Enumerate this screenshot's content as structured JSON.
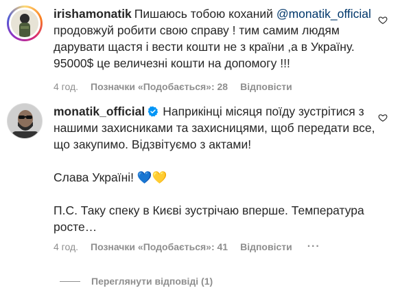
{
  "comments": [
    {
      "username": "irishamonatik",
      "text_before_mention": "Пишаюсь тобою коханий ",
      "mention": "@monatik_official",
      "text_lines": [
        "продовжуй робити свою справу ! тим самим людям",
        "дарувати щастя і вести кошти не з країни ,а в Україну.",
        "95000$ це величезні кошти на допомогу !!!"
      ],
      "time": "4 год.",
      "likes": "Позначки «Подобається»: 28",
      "reply_label": "Відповісти"
    },
    {
      "username": "monatik_official",
      "verified": true,
      "paragraphs": [
        "Наприкінці місяця поїду зустрітися з нашими захисниками та захисницями, щоб передати все, що закупимо. Відзвітуємо з актами!",
        "Слава Україні! 💙💛",
        "П.С. Таку спеку в Києві зустрічаю вперше. Температура росте…"
      ],
      "time": "4 год.",
      "likes": "Позначки «Подобається»: 41",
      "reply_label": "Відповісти",
      "more_label": "···"
    }
  ],
  "replies_toggle": "Переглянути відповіді (1)",
  "colors": {
    "text": "#262626",
    "meta": "#8e8e8e",
    "mention": "#00376b",
    "verified": "#0095f6"
  },
  "icons": [
    "heart-outline-icon",
    "verified-badge-icon"
  ]
}
